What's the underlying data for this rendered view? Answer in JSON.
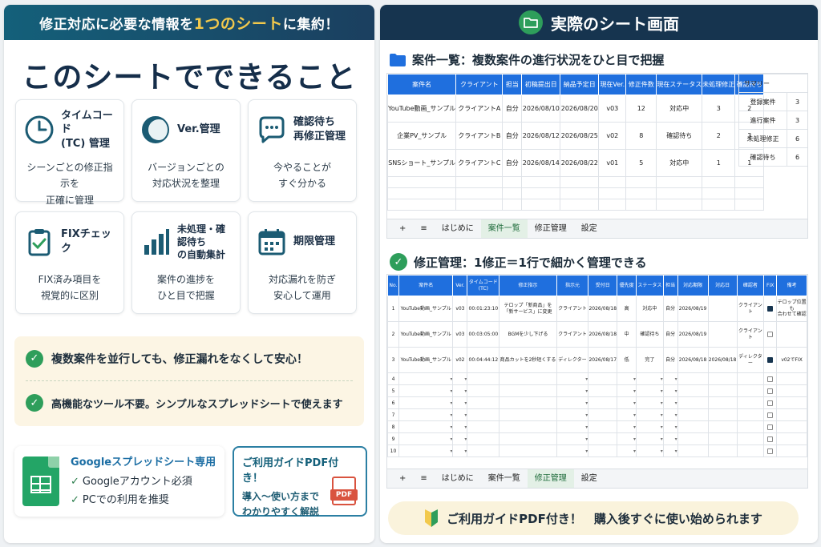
{
  "left": {
    "header": {
      "pre": "修正対応に必要な情報を",
      "highlight": "1つのシート",
      "post": "に集約！"
    },
    "title": "このシートでできること",
    "features": [
      {
        "icon": "clock-icon",
        "title": "タイムコード\n(TC) 管理",
        "desc": "シーンごとの修正指示を\n正確に管理"
      },
      {
        "icon": "version-icon",
        "title": "Ver.管理",
        "desc": "バージョンごとの\n対応状況を整理"
      },
      {
        "icon": "chat-bubble-icon",
        "title": "確認待ち\n再修正管理",
        "desc": "今やることが\nすぐ分かる"
      },
      {
        "icon": "clipboard-check-icon",
        "title": "FIXチェック",
        "desc": "FIX済み項目を\n視覚的に区別"
      },
      {
        "icon": "bar-chart-icon",
        "title": "未処理・確認待ち\nの自動集計",
        "desc": "案件の進捗を\nひと目で把握"
      },
      {
        "icon": "calendar-icon",
        "title": "期限管理",
        "desc": "対応漏れを防ぎ\n安心して運用"
      }
    ],
    "merits": [
      "複数案件を並行しても、修正漏れをなくして安心！",
      "高機能なツール不要。シンプルなスプレッドシートで使えます"
    ],
    "google": {
      "title": "Googleスプレッドシート専用",
      "items": [
        "Googleアカウント必須",
        "PCでの利用を推奨"
      ]
    },
    "pdf": {
      "title": "ご利用ガイドPDF付き！",
      "desc": "導入〜使い方まで\nわかりやすく解説",
      "icon_label": "PDF"
    }
  },
  "right": {
    "header": "実際のシート画面",
    "section1": "案件一覧：複数案件の進行状況をひと目で把握",
    "table1": {
      "headers": [
        "案件名",
        "クライアント",
        "担当",
        "初稿提出日",
        "納品予定日",
        "現在Ver.",
        "修正件数",
        "現在ステータス",
        "未処理修正",
        "確認待ち"
      ],
      "rows": [
        [
          "YouTube動画_サンプル",
          "クライアントA",
          "自分",
          "2026/08/10",
          "2026/08/20",
          "v03",
          "12",
          "対応中",
          "3",
          "2"
        ],
        [
          "企業PV_サンプル",
          "クライアントB",
          "自分",
          "2026/08/12",
          "2026/08/25",
          "v02",
          "8",
          "確認待ち",
          "2",
          "3"
        ],
        [
          "SNSショート_サンプル",
          "クライアントC",
          "自分",
          "2026/08/14",
          "2026/08/22",
          "v01",
          "5",
          "対応中",
          "1",
          "1"
        ]
      ]
    },
    "summary": {
      "title": "サマリー",
      "rows": [
        [
          "登録案件",
          "3"
        ],
        [
          "進行案件",
          "3"
        ],
        [
          "未処理修正",
          "6"
        ],
        [
          "確認待ち",
          "6"
        ]
      ]
    },
    "tabs1": {
      "plus": "+",
      "menu": "≡",
      "items": [
        "はじめに",
        "案件一覧",
        "修正管理",
        "設定"
      ],
      "active": 1
    },
    "section2": "修正管理：1修正＝1行で細かく管理できる",
    "table2": {
      "headers": [
        "No.",
        "案件名",
        "Ver.",
        "タイムコード\n(TC)",
        "修正指示",
        "指示元",
        "受付日",
        "優先度",
        "ステータス",
        "担当",
        "対応期限",
        "対応日",
        "確認者",
        "FIX",
        "備考"
      ],
      "rows": [
        [
          "1",
          "YouTube動画_サンプル",
          "v03",
          "00:01:23:10",
          "テロップ「新商品」を\n「新サービス」に変更",
          "クライアント",
          "2026/08/18",
          "高",
          "対応中",
          "自分",
          "2026/08/19",
          "",
          "クライアント",
          "on",
          "テロップ位置も\n合わせて確認"
        ],
        [
          "2",
          "YouTube動画_サンプル",
          "v03",
          "00:03:05:00",
          "BGMを少し下げる",
          "クライアント",
          "2026/08/18",
          "中",
          "確認待ち",
          "自分",
          "2026/08/19",
          "",
          "クライアント",
          "off",
          ""
        ],
        [
          "3",
          "YouTube動画_サンプル",
          "v02",
          "00:04:44:12",
          "商品カットを2秒短くする",
          "ディレクター",
          "2026/08/17",
          "低",
          "完了",
          "自分",
          "2026/08/18",
          "2026/08/18",
          "ディレクター",
          "on",
          "v02でFIX"
        ]
      ],
      "empty_rows": [
        "4",
        "5",
        "6",
        "7",
        "8",
        "9",
        "10"
      ]
    },
    "tabs2": {
      "plus": "+",
      "menu": "≡",
      "items": [
        "はじめに",
        "案件一覧",
        "修正管理",
        "設定"
      ],
      "active": 2
    },
    "banner": "ご利用ガイドPDF付き！　購入後すぐに使い始められます"
  }
}
